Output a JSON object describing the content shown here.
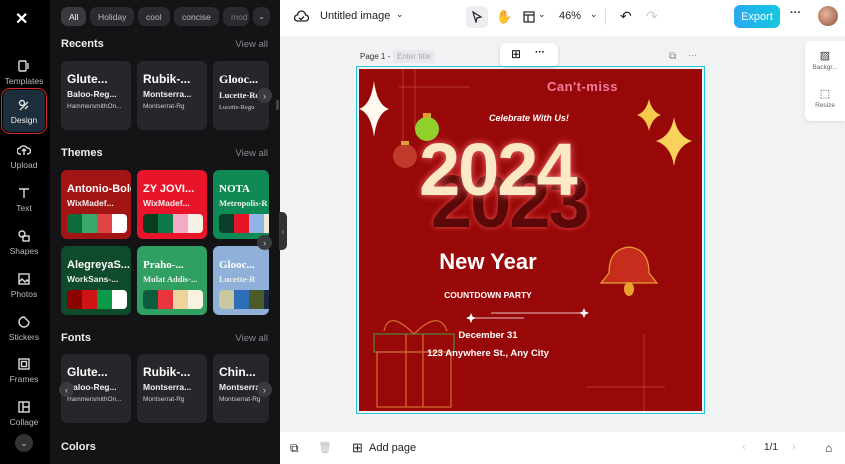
{
  "rail": {
    "items": [
      {
        "label": "Templates"
      },
      {
        "label": "Design"
      },
      {
        "label": "Upload"
      },
      {
        "label": "Text"
      },
      {
        "label": "Shapes"
      },
      {
        "label": "Photos"
      },
      {
        "label": "Stickers"
      },
      {
        "label": "Frames"
      },
      {
        "label": "Collage"
      }
    ]
  },
  "panel": {
    "chips": [
      "All",
      "Holiday",
      "cool",
      "concise",
      "mod"
    ],
    "recents": {
      "title": "Recents",
      "view_all": "View all",
      "cards": [
        {
          "a": "Glute...",
          "b": "Baloo-Reg...",
          "c": "HammersmithOn..."
        },
        {
          "a": "Rubik-...",
          "b": "Montserra...",
          "c": "Montserrat-Rg"
        },
        {
          "a": "Glooc...",
          "b": "Lucette-Regu",
          "c": "Lucette-Regu"
        }
      ]
    },
    "themes": {
      "title": "Themes",
      "view_all": "View all",
      "cards": [
        {
          "a": "Antonio-Bold",
          "b": "WixMadef...",
          "bg": "#a31515",
          "colors": [
            "#0d6b3a",
            "#3aa86b",
            "#e04545",
            "#ffffff"
          ]
        },
        {
          "a": "ZY JOVI...",
          "b": "WixMadef...",
          "bg": "#e8142a",
          "colors": [
            "#0a3d1e",
            "#0a7a4a",
            "#f4a9c4",
            "#f4f0e6"
          ]
        },
        {
          "a": "NOTA",
          "b": "Metropolis-R",
          "bg": "#0f8a55",
          "colors": [
            "#0a3d2a",
            "#e8142a",
            "#8fb4e8",
            "#f4e8d0"
          ]
        },
        {
          "a": "AlegreyaS...",
          "b": "WorkSans-...",
          "bg": "#0e4a2c",
          "colors": [
            "#8b0000",
            "#d01414",
            "#0a9a4a",
            "#ffffff"
          ]
        },
        {
          "a": "Praho-...",
          "b": "Mulat Addis-...",
          "bg": "#2fa062",
          "colors": [
            "#0c5c40",
            "#e8343c",
            "#ecd49c",
            "#f8f2e0"
          ]
        },
        {
          "a": "Glooc...",
          "b": "Lucette-R",
          "bg": "#8fb0d8",
          "colors": [
            "#c8c8a0",
            "#2e6eb8",
            "#4a5a28",
            "#1a2a40"
          ]
        }
      ]
    },
    "fonts": {
      "title": "Fonts",
      "view_all": "View all",
      "cards": [
        {
          "a": "Glute...",
          "b": "Baloo-Reg...",
          "c": "HammersmithOn..."
        },
        {
          "a": "Rubik-...",
          "b": "Montserra...",
          "c": "Montserrat-Rg"
        },
        {
          "a": "Chin...",
          "b": "Montserrat",
          "c": "Montserrat-Rg"
        }
      ]
    },
    "colors": {
      "title": "Colors"
    }
  },
  "topbar": {
    "title": "Untitled image",
    "zoom": "46%",
    "export": "Export"
  },
  "canvas": {
    "page_label": "Page 1 -",
    "title_placeholder": "Enter title"
  },
  "side_tools": [
    {
      "label": "Backgr..."
    },
    {
      "label": "Resize"
    }
  ],
  "poster": {
    "cant_miss": "Can't-miss",
    "celebrate": "Celebrate With Us!",
    "year_new": "2024",
    "year_old": "2023",
    "heading": "New Year",
    "sub": "COUNTDOWN PARTY",
    "date": "December 31",
    "address": "123 Anywhere St., Any City"
  },
  "bottombar": {
    "add_page": "Add page",
    "pages": "1/1"
  },
  "colors": {
    "accent": "#1fb6e8",
    "poster_bg": "#980808",
    "selection": "#25c3d8"
  }
}
